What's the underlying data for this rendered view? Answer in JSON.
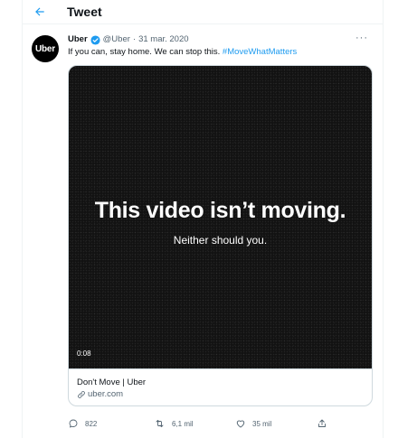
{
  "header": {
    "title": "Tweet",
    "back_icon": "arrow-left-icon"
  },
  "tweet": {
    "avatar_text": "Uber",
    "name": "Uber",
    "handle": "@Uber",
    "separator": "·",
    "date": "31 mar. 2020",
    "more": "···",
    "text": "If you can, stay home. We can stop this. ",
    "hashtag": "#MoveWhatMatters"
  },
  "card": {
    "video_headline": "This video isn’t moving.",
    "video_subtext": "Neither should you.",
    "duration": "0:08",
    "title": "Don't Move | Uber",
    "domain": "uber.com"
  },
  "actions": {
    "replies": "822",
    "retweets": "6,1 mil",
    "likes": "35 mil"
  },
  "colors": {
    "accent": "#1d9bf0",
    "muted": "#536471",
    "border": "#cfd9de"
  }
}
